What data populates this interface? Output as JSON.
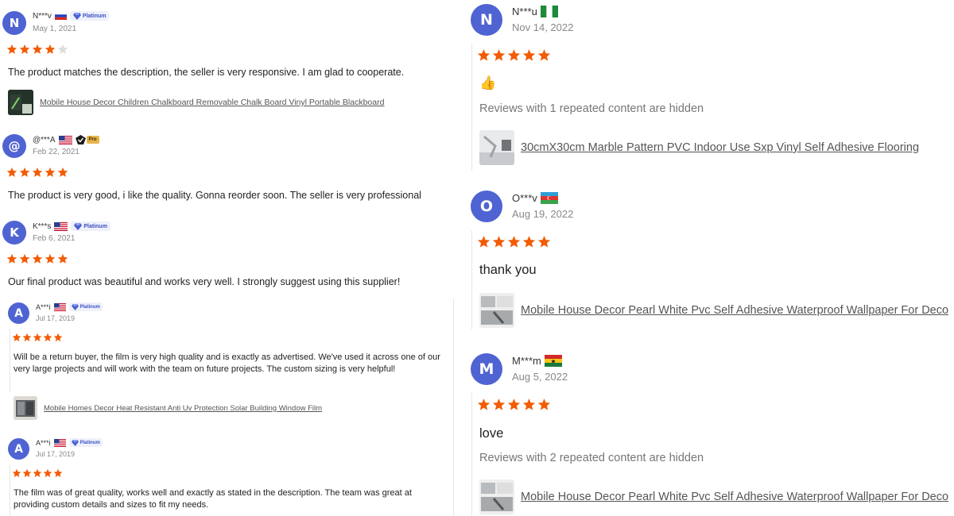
{
  "left_reviews": [
    {
      "initial": "N",
      "name": "N***v",
      "flag": "ru",
      "badge": "Platinum",
      "date": "May 1, 2021",
      "rating": 4,
      "text": "The product matches the description, the seller is very responsive. I am glad to cooperate.",
      "product": "Mobile House Decor Children Chalkboard Removable Chalk Board Vinyl Portable Blackboard"
    },
    {
      "initial": "@",
      "name": "@***A",
      "flag": "us",
      "badge": "Pro",
      "date": "Feb 22, 2021",
      "rating": 5,
      "text": "The product is very good, i like the quality. Gonna reorder soon. The seller is very professional"
    },
    {
      "initial": "K",
      "name": "K***s",
      "flag": "us",
      "badge": "Platinum",
      "date": "Feb 6, 2021",
      "rating": 5,
      "text": "Our final product was beautiful and works very well. I strongly suggest using this supplier!"
    },
    {
      "initial": "A",
      "name": "A***i",
      "flag": "us",
      "badge": "Platinum",
      "date": "Jul 17, 2019",
      "rating": 5,
      "text": "Will be a return buyer, the film is very high quality and is exactly as advertised. We've used it across one of our very large projects and will work with the team on future projects. The custom sizing is very helpful!",
      "product": "Mobile Homes Decor Heat Resistant Anti Uv Protection Solar Building Window Film"
    },
    {
      "initial": "A",
      "name": "A***i",
      "flag": "us",
      "badge": "Platinum",
      "date": "Jul 17, 2019",
      "rating": 5,
      "text": "The film was of great quality, works well and exactly as stated in the description. The team was great at providing custom details and sizes to fit my needs."
    }
  ],
  "right_reviews": [
    {
      "initial": "N",
      "name": "N***u",
      "flag": "ng",
      "date": "Nov 14, 2022",
      "rating": 5,
      "emoji": "👍",
      "hidden": "Reviews with 1 repeated content are hidden",
      "product": "30cmX30cm Marble Pattern PVC Indoor Use Sxp Vinyl Self Adhesive Flooring"
    },
    {
      "initial": "O",
      "name": "O***v",
      "flag": "az",
      "date": "Aug 19, 2022",
      "rating": 5,
      "text": "thank you",
      "product": "Mobile House Decor Pearl White Pvc Self Adhesive Waterproof Wallpaper For Deco"
    },
    {
      "initial": "M",
      "name": "M***m",
      "flag": "gh",
      "date": "Aug 5, 2022",
      "rating": 5,
      "text": "love",
      "hidden": "Reviews with 2 repeated content are hidden",
      "product": "Mobile House Decor Pearl White Pvc Self Adhesive Waterproof Wallpaper For Deco"
    }
  ],
  "colors": {
    "star": "#f25c05",
    "star_empty": "#dddddd",
    "avatar": "#4f63d2"
  }
}
